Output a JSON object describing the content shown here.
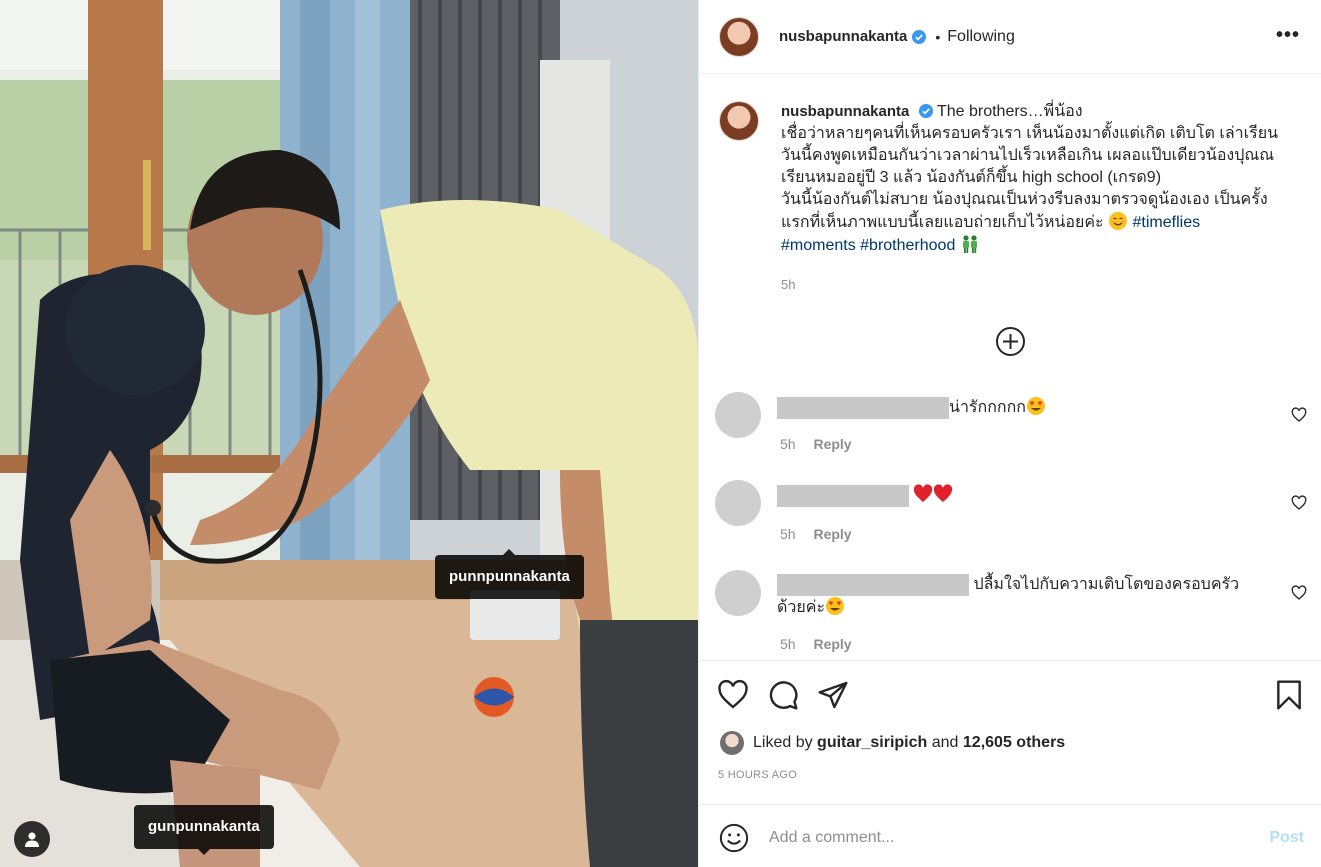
{
  "post": {
    "author": "nusbapunnakanta",
    "separator": "•",
    "follow_status": "Following",
    "more_label": "•••"
  },
  "photo": {
    "tags": [
      {
        "username": "punnpunnakanta"
      },
      {
        "username": "gunpunnakanta"
      }
    ]
  },
  "caption": {
    "username": "nusbapunnakanta",
    "title": "The brothers…พี่น้อง",
    "lines": [
      "เชื่อว่าหลายๆคนที่เห็นครอบครัวเรา เห็นน้องมาตั้งแต่เกิด เติบโต เล่าเรียน",
      "วันนี้คงพูดเหมือนกันว่าเวลาผ่านไปเร็วเหลือเกิน เผลอแป๊บเดียวน้องปุณณ",
      "เรียนหมออยู่ปี 3 แล้ว น้องกันต์ก็ขึ้น high school (เกรด9)",
      "วันนี้น้องกันต์ไม่สบาย น้องปุณณเป็นห่วงรีบลงมาตรวจดูน้องเอง เป็นครั้ง",
      "แรกที่เห็นภาพแบบนี้เลยแอบถ่ายเก็บไว้หน่อยค่ะ"
    ],
    "hashtags": [
      "#timeflies",
      "#moments",
      "#brotherhood"
    ],
    "time": "5h"
  },
  "comments": [
    {
      "text": "น่ารักกกกก",
      "time": "5h",
      "reply_label": "Reply"
    },
    {
      "text": "",
      "time": "5h",
      "reply_label": "Reply"
    },
    {
      "text": "ปลื้มใจไปกับความเติบโตของครอบครัว",
      "text2": "ด้วยค่ะ",
      "time": "5h",
      "reply_label": "Reply"
    }
  ],
  "likes": {
    "prefix": "Liked by",
    "user": "guitar_siripich",
    "middle": "and",
    "count": "12,605 others"
  },
  "timestamp": "5 HOURS AGO",
  "add_comment": {
    "placeholder": "Add a comment...",
    "post_label": "Post"
  },
  "colors": {
    "verified": "#3897f0",
    "hashtag": "#00376b",
    "post_disabled": "#b2dffc",
    "meta": "#8e8e8e"
  }
}
